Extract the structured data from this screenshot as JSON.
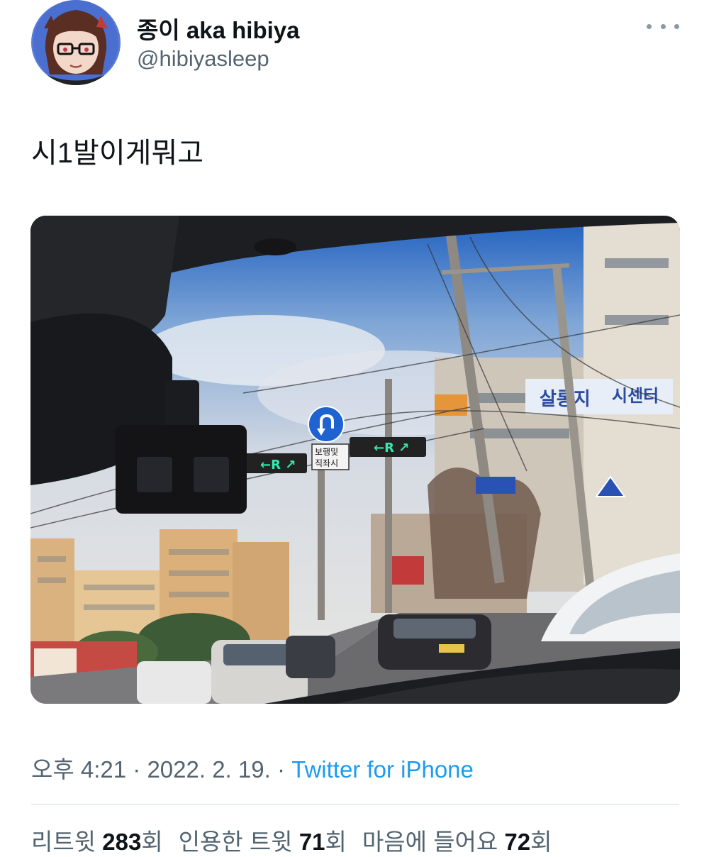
{
  "author": {
    "display_name": "종이 aka hibiya",
    "handle": "@hibiyasleep",
    "avatar_icon": "anime-avatar-icon"
  },
  "tweet": {
    "text": "시1발이게뭐고"
  },
  "media": {
    "description_icon": "photo-through-car-windshield",
    "signs": {
      "u_turn_note_line1": "보행및",
      "u_turn_note_line2": "직좌시",
      "banner_right": "시센터",
      "banner_left": "살롱지"
    }
  },
  "meta": {
    "time": "오후 4:21",
    "sep1": " · ",
    "date": "2022. 2. 19.",
    "sep2": " · ",
    "source": "Twitter for iPhone"
  },
  "stats": {
    "retweets_label": "리트윗 ",
    "retweets": "283",
    "retweets_unit": "회",
    "quotes_label": "인용한 트윗 ",
    "quotes": "71",
    "quotes_unit": "회",
    "likes_label": "마음에 들어요 ",
    "likes": "72",
    "likes_unit": "회"
  },
  "colors": {
    "link": "#1d9bf0",
    "secondary_text": "#536471",
    "primary_text": "#0f1419"
  }
}
